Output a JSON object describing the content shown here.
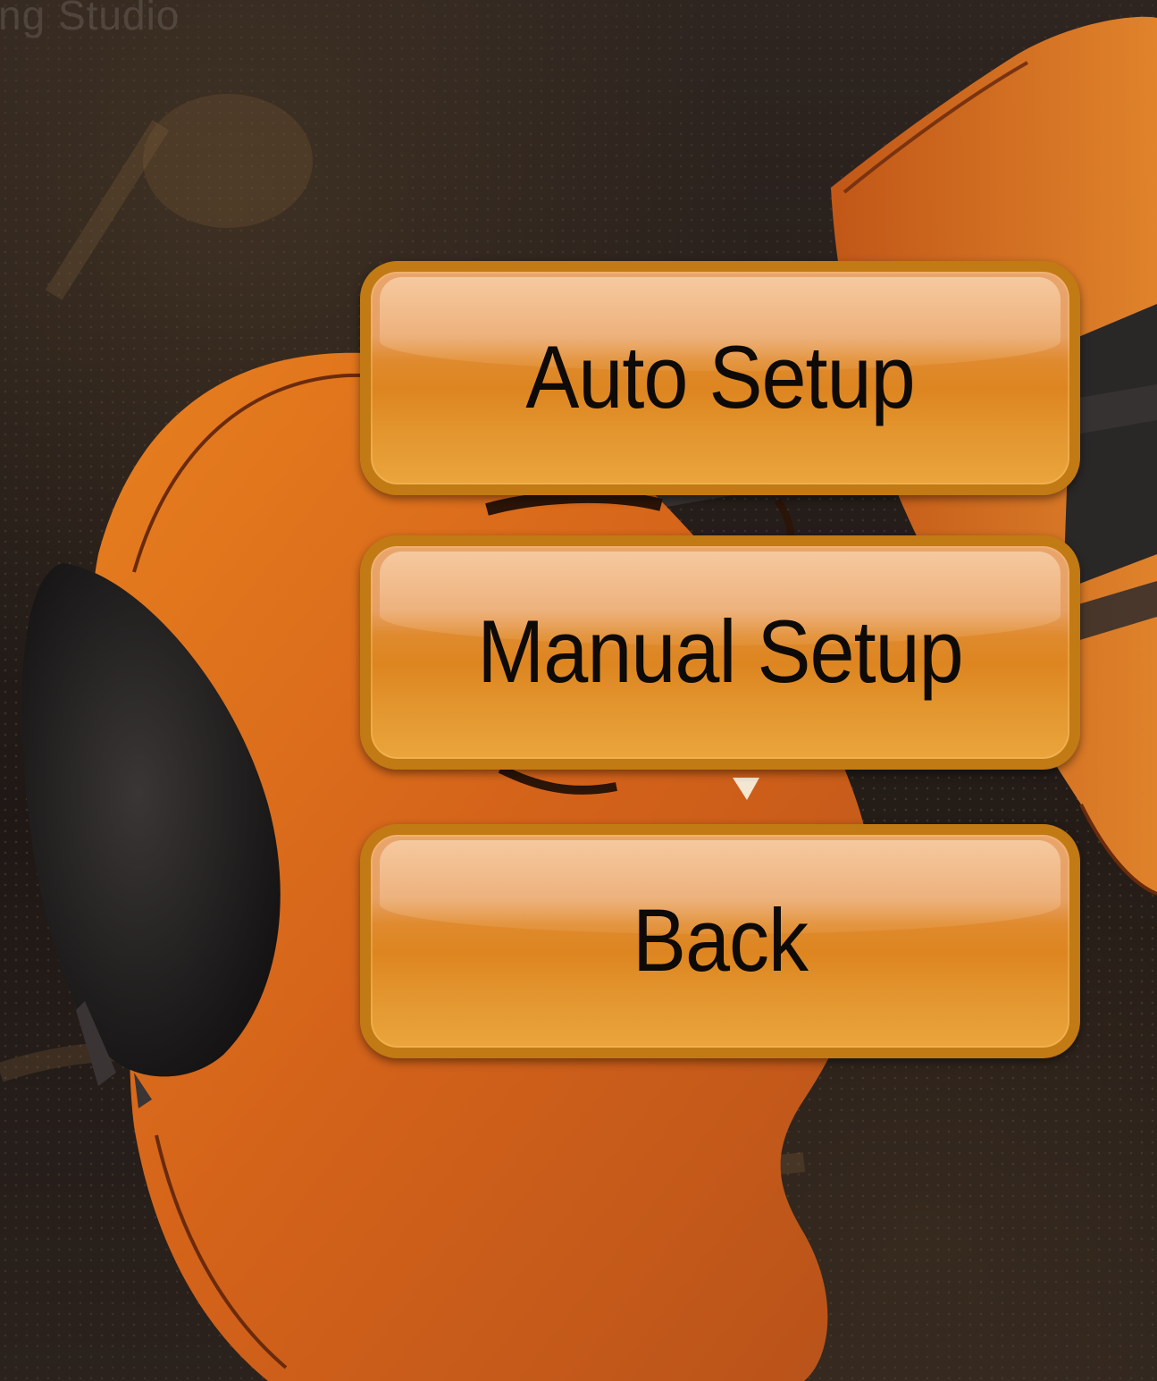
{
  "watermark_text": "ng Studio",
  "menu": {
    "auto_setup_label": "Auto Setup",
    "manual_setup_label": "Manual Setup",
    "back_label": "Back"
  },
  "colors": {
    "button_border": "#c27a14",
    "button_fill": "#dd8520",
    "violin_body": "#d86a1c",
    "background": "#2a201b"
  },
  "icons": {
    "background_illustration": "violin-illustration"
  }
}
